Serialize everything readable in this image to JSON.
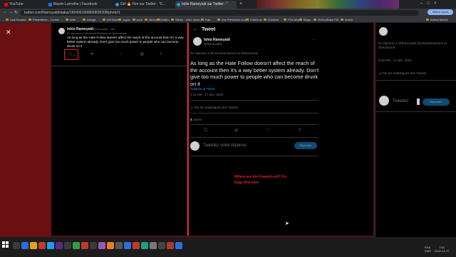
{
  "tabs": [
    {
      "label": "YouTube",
      "color": "#ff0000"
    },
    {
      "label": "Maxim Lamothe | Facebook",
      "color": "#1877f2"
    },
    {
      "label": "Girl 🔥 Fire sur Twitter : \"C...",
      "color": "#1d9bf0"
    },
    {
      "label": "Ishio Ramoyald sur Twitter : \"",
      "color": "#1d9bf0"
    }
  ],
  "url": "twitter.com/Ramoyald/status/1604361908600835208/photo/1",
  "profile_button": "Mettre à jour",
  "bookmarks": [
    "Last Session",
    "Paramètres - Cookie...",
    "Web",
    "manga",
    "Wii Hack",
    "crypto",
    "porn",
    "Minecraft",
    "Diablo",
    "Weibo - serio nacio...",
    "Rap",
    "Vos Prévisions local...",
    "Pokemon",
    "Finished",
    "FO4 Mods",
    "Mags",
    "TechnoBase.FM",
    "Anime",
    "Autres favoris"
  ],
  "left_tweet": {
    "name": "Ishio Ramoyald",
    "handle": "@Ramoyald · 16h",
    "reply_to": "En réponse à @UnwokSolutions et @elonmusk",
    "text": "As long as the Hate Follow doesn't affect the reach of the account then it's a way better system already. Don't give too much power to people who can become drunk on it",
    "reply_count": "1"
  },
  "right_panel": {
    "header": "Tweet",
    "name": "Ishio Ramoyald",
    "handle": "@Ramoyald",
    "reply_to": "En réponse à @UnwokSolutions et @elonmusk",
    "text": "As long as the Hate Follow doesn't affect the reach of the account then it's a way better system already. Don't give too much power to people who can become drunk on it",
    "translate": "Traduire le Tweet",
    "time": "2:13 AM · 17 déc. 2022",
    "stats": "Voir les statistiques des Tweets",
    "likes_count": "2",
    "likes_label": "J'aime",
    "reply_placeholder": "Tweetez votre réponse",
    "reply_button": "Répondre",
    "annotation": "Where are the 4 tweets eh? Fix bugs first elon"
  },
  "sidebar": {
    "reply_to": "En réponse à @Ramoyald @UnwokSolutions et @elonmusk",
    "time": "6:45 PM · 17 déc. 2022",
    "stats": "Voir les statistiques des Tweets",
    "compose_placeholder": "Tweetez",
    "reply_button": "Répondre"
  },
  "taskbar": {
    "lang": "FRA",
    "region": "CMS",
    "time": "7:01",
    "date": "2022-12-17"
  },
  "colors": {
    "accent": "#1d9bf0",
    "annotation": "#e0202a",
    "background_red": "#5a0e10"
  }
}
